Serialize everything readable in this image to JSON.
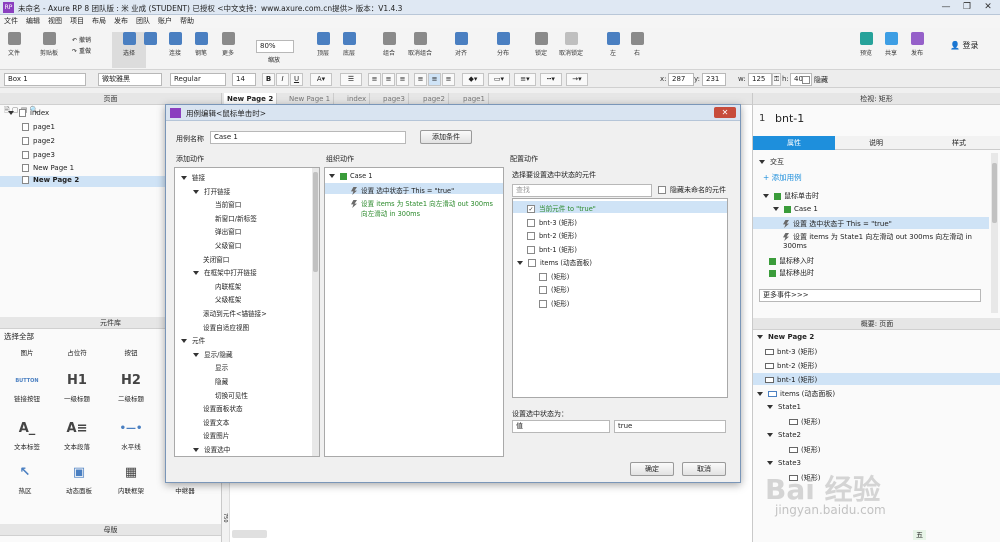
{
  "app": {
    "title": "未命名 - Axure RP 8 团队版 : 米 业成 (STUDENT) 已授权 <中文支持：www.axure.com.cn提供> 版本：V1.4.3",
    "icon": "axure-icon"
  },
  "menu": [
    "文件",
    "编辑",
    "视图",
    "项目",
    "布局",
    "发布",
    "团队",
    "账户",
    "帮助"
  ],
  "toolbar": {
    "file": "文件",
    "clipboard": "剪贴板",
    "undo": "撤销",
    "redo": "重做",
    "select": "选择",
    "connect": "连接",
    "pen": "钢笔",
    "more": "更多",
    "zoom_value": "80%",
    "zoom": "缩放",
    "top": "顶层",
    "bottom": "底层",
    "group": "组合",
    "ungroup": "取消组合",
    "align": "对齐",
    "distribute": "分布",
    "lock": "锁定",
    "unlock": "取消锁定",
    "left": "左",
    "right": "右",
    "preview": "预览",
    "share": "共享",
    "publish": "发布",
    "login": "登录"
  },
  "format": {
    "widget_name": "Box 1",
    "font": "微软雅黑",
    "style": "Regular",
    "size": "14",
    "bold": "B",
    "italic": "I",
    "underline": "U",
    "x_label": "x:",
    "x": "287",
    "y_label": "y:",
    "y": "231",
    "w_label": "w:",
    "w": "125",
    "h_label": "h:",
    "h": "40",
    "hide": "隐藏"
  },
  "pages_panel": {
    "title": "页面",
    "items": [
      "index",
      "page1",
      "page2",
      "page3",
      "New Page 1",
      "New Page 2"
    ]
  },
  "library": {
    "title": "元件库",
    "select": "选择全部",
    "row0": [
      "图片",
      "占位符",
      "按钮"
    ],
    "widgets": [
      {
        "icon": "BUTTON",
        "label": "链接按钮"
      },
      {
        "icon": "H1",
        "label": "一级标题"
      },
      {
        "icon": "H2",
        "label": "二级标题"
      },
      {
        "icon": "A_",
        "label": "文本标签"
      },
      {
        "icon": "A≡",
        "label": "文本段落"
      },
      {
        "icon": "•—•",
        "label": "水平线"
      },
      {
        "icon": "↖",
        "label": "热区"
      },
      {
        "icon": "▣",
        "label": "动态面板"
      },
      {
        "icon": "▦",
        "label": "内联框架"
      },
      {
        "icon": "▤",
        "label": "中继器"
      }
    ],
    "masters": "母版"
  },
  "doc_tabs": [
    "New Page 2",
    "New Page 1",
    "index",
    "page3",
    "page2",
    "page1"
  ],
  "ruler_mark": "750",
  "inspector": {
    "header": "检视: 矩形",
    "index": "1",
    "name": "bnt-1",
    "tabs": [
      "属性",
      "说明",
      "样式"
    ],
    "section": "交互",
    "add_case": "添加用例",
    "events": {
      "onclick": "鼠标单击时",
      "case": "Case 1",
      "action1": "设置 选中状态于 This = \"true\"",
      "action2": "设置 items 为 State1 向左滑动 out 300ms 向左滑动 in 300ms",
      "mouse_enter": "鼠标移入时",
      "mouse_out": "鼠标移出时"
    },
    "more_events": "更多事件>>>"
  },
  "outline": {
    "tabs": "概要: 页面",
    "items": [
      "New Page 2",
      "bnt-3 (矩形)",
      "bnt-2 (矩形)",
      "bnt-1 (矩形)",
      "items (动态面板)",
      "State1",
      "(矩形)",
      "State2",
      "(矩形)",
      "State3",
      "(矩形)"
    ]
  },
  "dialog": {
    "title": "用例编辑<鼠标单击时>",
    "case_name_label": "用例名称",
    "case_name": "Case 1",
    "add_condition": "添加条件",
    "add_action": "添加动作",
    "organize": "组织动作",
    "configure": "配置动作",
    "actions": [
      {
        "text": "链接",
        "level": 0,
        "arrow": true
      },
      {
        "text": "打开链接",
        "level": 1,
        "arrow": true
      },
      {
        "text": "当前窗口",
        "level": 2
      },
      {
        "text": "新窗口/新标签",
        "level": 2
      },
      {
        "text": "弹出窗口",
        "level": 2
      },
      {
        "text": "父级窗口",
        "level": 2
      },
      {
        "text": "关闭窗口",
        "level": 1
      },
      {
        "text": "在框架中打开链接",
        "level": 1,
        "arrow": true
      },
      {
        "text": "内联框架",
        "level": 2
      },
      {
        "text": "父级框架",
        "level": 2
      },
      {
        "text": "滚动到元件<锚链接>",
        "level": 1
      },
      {
        "text": "设置自适应视图",
        "level": 1
      },
      {
        "text": "元件",
        "level": 0,
        "arrow": true
      },
      {
        "text": "显示/隐藏",
        "level": 1,
        "arrow": true
      },
      {
        "text": "显示",
        "level": 2
      },
      {
        "text": "隐藏",
        "level": 2
      },
      {
        "text": "切换可见性",
        "level": 2
      },
      {
        "text": "设置面板状态",
        "level": 1
      },
      {
        "text": "设置文本",
        "level": 1
      },
      {
        "text": "设置图片",
        "level": 1
      },
      {
        "text": "设置选中",
        "level": 1,
        "arrow": true
      }
    ],
    "org_case": "Case 1",
    "org_action1": "设置 选中状态于 This = \"true\"",
    "org_action2_a": "设置 items 为 State1 向左滑动 out 300ms",
    "org_action2_b": "向左滑动 in 300ms",
    "select_label": "选择要设置选中状态的元件",
    "search_placeholder": "查找",
    "hide_unnamed": "隐藏未命名的元件",
    "targets": [
      {
        "text": "当前元件 to \"true\"",
        "checked": true,
        "indent": 0,
        "color": "green"
      },
      {
        "text": "bnt-3 (矩形)",
        "checked": false,
        "indent": 0
      },
      {
        "text": "bnt-2 (矩形)",
        "checked": false,
        "indent": 0
      },
      {
        "text": "bnt-1 (矩形)",
        "checked": false,
        "indent": 0
      },
      {
        "text": "items (动态面板)",
        "checked": false,
        "indent": 0,
        "arrow": true
      },
      {
        "text": "(矩形)",
        "checked": false,
        "indent": 1
      },
      {
        "text": "(矩形)",
        "checked": false,
        "indent": 1
      },
      {
        "text": "(矩形)",
        "checked": false,
        "indent": 1
      }
    ],
    "set_state_label": "设置选中状态为：",
    "value_type": "值",
    "value": "true",
    "ok": "确定",
    "cancel": "取消"
  },
  "watermark": {
    "brand": "Bai 经验",
    "url": "jingyan.baidu.com"
  },
  "taskbar": "五"
}
